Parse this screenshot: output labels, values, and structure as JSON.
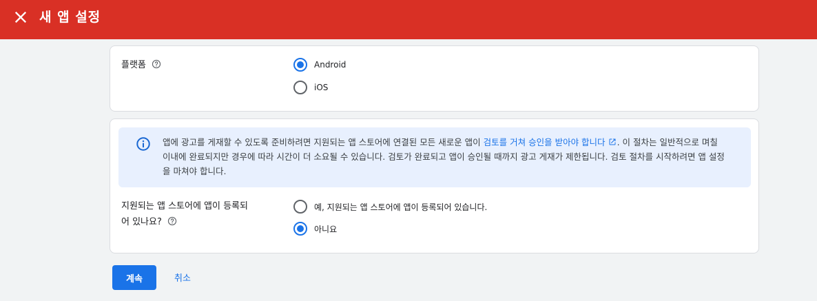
{
  "header": {
    "title": "새 앱 설정"
  },
  "platform": {
    "label": "플랫폼",
    "options": [
      {
        "label": "Android",
        "selected": true
      },
      {
        "label": "iOS",
        "selected": false
      }
    ]
  },
  "notice": {
    "text_before": "앱에 광고를 게재할 수 있도록 준비하려면 지원되는 앱 스토어에 연결된 모든 새로운 앱이 ",
    "link": "검토를 거쳐 승인을 받아야 합니다",
    "text_after": ". 이 절차는 일반적으로 며칠 이내에 완료되지만 경우에 따라 시간이 더 소요될 수 있습니다. 검토가 완료되고 앱이 승인될 때까지 광고 게재가 제한됩니다. 검토 절차를 시작하려면 앱 설정을 마쳐야 합니다."
  },
  "store_question": {
    "label_line1": "지원되는 앱 스토어에 앱이 등록되",
    "label_line2": "어 있나요?",
    "options": [
      {
        "label": "예, 지원되는 앱 스토어에 앱이 등록되어 있습니다.",
        "selected": false
      },
      {
        "label": "아니요",
        "selected": true
      }
    ]
  },
  "actions": {
    "continue_label": "계속",
    "cancel_label": "취소"
  },
  "colors": {
    "header_bg": "#d93025",
    "accent": "#1a73e8",
    "info_bg": "#e8f0fe"
  },
  "icons": {
    "close": "close-icon",
    "help": "help-circle-icon",
    "info": "info-icon",
    "external_link": "external-link-icon"
  }
}
